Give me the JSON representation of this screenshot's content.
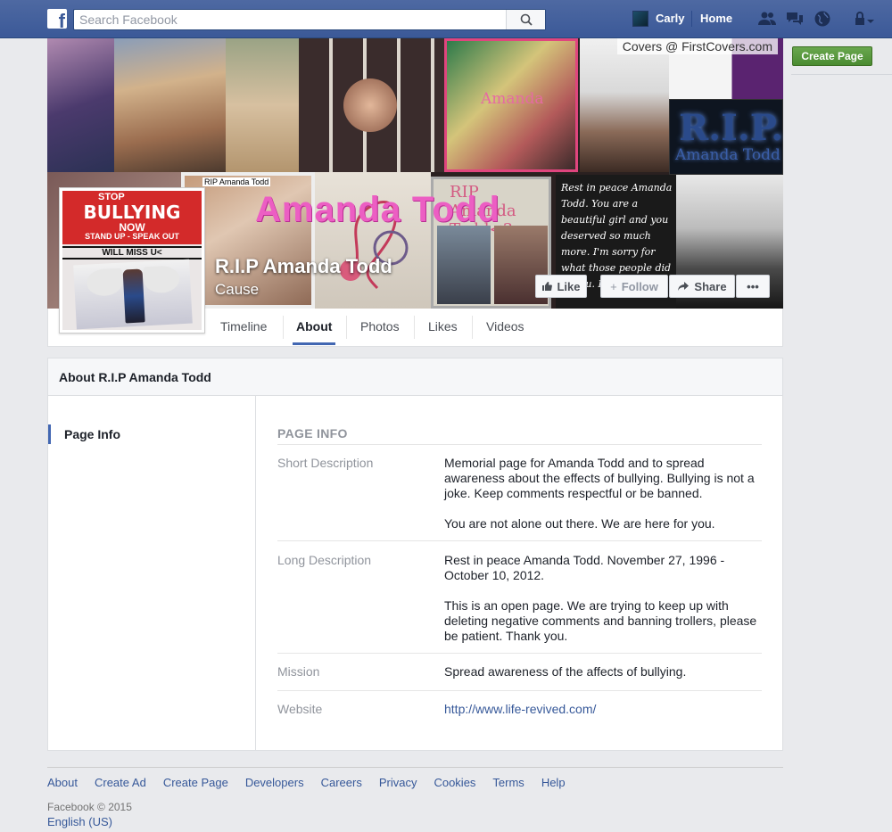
{
  "topbar": {
    "search_placeholder": "Search Facebook",
    "user_name": "Carly",
    "home_label": "Home",
    "icons": [
      "facebook-logo-icon",
      "search-icon",
      "friend-requests-icon",
      "messages-icon",
      "notifications-icon",
      "privacy-shortcuts-icon"
    ]
  },
  "cover": {
    "credit": "Covers @ FirstCovers.com",
    "overlay_text": "Amanda Todd",
    "page_name": "R.I.P Amanda Todd",
    "category": "Cause",
    "like_label": "Like",
    "follow_label": "Follow",
    "share_label": "Share",
    "more_label": "•••",
    "collage_texts": {
      "rip_box": "R.I.P.",
      "rip_box_name": "Amanda Todd",
      "poem": "Rest in peace Amanda Todd. You are a beautiful girl and you deserved so much more. I'm sorry for what those people did to you. I",
      "rip_small": "RIP Amanda Todd<3",
      "amanda_small": "Amanda"
    }
  },
  "profile_pic": {
    "line1": "STOP",
    "line2": "BULLYING",
    "line3": "NOW",
    "line4": "STAND UP - SPEAK OUT",
    "line5": "WILL MISS U<"
  },
  "nav": {
    "tabs": [
      "Timeline",
      "About",
      "Photos",
      "Likes",
      "Videos"
    ],
    "active": "About"
  },
  "right_col": {
    "create_page": "Create Page"
  },
  "about": {
    "title": "About R.I.P Amanda Todd",
    "side_item": "Page Info",
    "heading": "PAGE INFO",
    "rows": [
      {
        "label": "Short Description",
        "paragraphs": [
          "Memorial page for Amanda Todd and to spread awareness about the effects of bullying. Bullying is not a joke. Keep comments respectful or be banned.",
          "You are not alone out there. We are here for you."
        ]
      },
      {
        "label": "Long Description",
        "paragraphs": [
          "Rest in peace Amanda Todd. November 27, 1996 - October 10, 2012.",
          "This is an open page. We are trying to keep up with deleting negative comments and banning trollers, please be patient. Thank you."
        ]
      },
      {
        "label": "Mission",
        "paragraphs": [
          "Spread awareness of the affects of bullying."
        ]
      },
      {
        "label": "Website",
        "link": "http://www.life-revived.com/"
      }
    ]
  },
  "footer": {
    "links": [
      "About",
      "Create Ad",
      "Create Page",
      "Developers",
      "Careers",
      "Privacy",
      "Cookies",
      "Terms",
      "Help"
    ],
    "copyright": "Facebook © 2015",
    "language": "English (US)"
  },
  "colors": {
    "brand": "#3b5998",
    "link": "#365899",
    "create_page_green": "#4a8b31",
    "cover_overlay_pink": "#ec5ec3"
  }
}
